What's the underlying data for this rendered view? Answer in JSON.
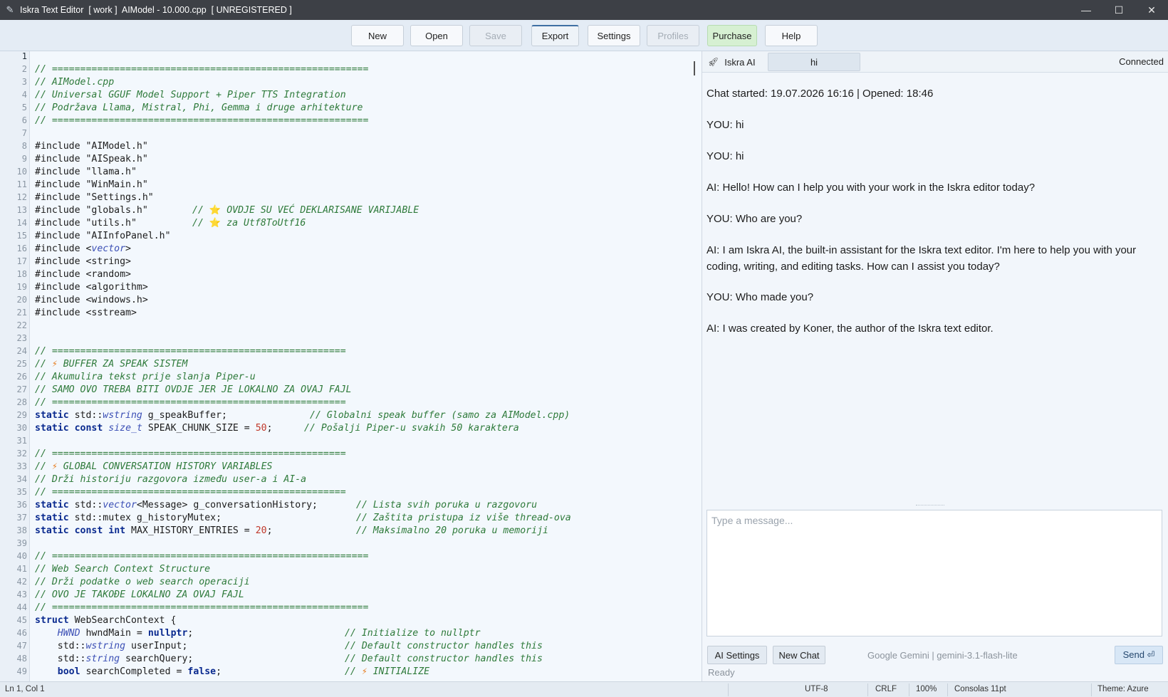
{
  "window": {
    "title": "Iskra Text Editor  [ work ]  AIModel - 10.000.cpp  [ UNREGISTERED ]",
    "app_icon": "quill-pen-icon"
  },
  "toolbar": {
    "new": "New",
    "open": "Open",
    "save": "Save",
    "export": "Export",
    "settings": "Settings",
    "profiles": "Profiles",
    "purchase": "Purchase",
    "help": "Help"
  },
  "editor": {
    "language": "cpp",
    "lines": [
      {
        "n": "1",
        "code": ""
      },
      {
        "n": "2",
        "code": "// ========================================================"
      },
      {
        "n": "3",
        "code": "// AIModel.cpp"
      },
      {
        "n": "4",
        "code": "// Universal GGUF Model Support + Piper TTS Integration"
      },
      {
        "n": "5",
        "code": "// Podržava Llama, Mistral, Phi, Gemma i druge arhitekture"
      },
      {
        "n": "6",
        "code": "// ========================================================"
      },
      {
        "n": "7",
        "code": ""
      },
      {
        "n": "8",
        "code": "#include \"AIModel.h\""
      },
      {
        "n": "9",
        "code": "#include \"AISpeak.h\""
      },
      {
        "n": "10",
        "code": "#include \"llama.h\""
      },
      {
        "n": "11",
        "code": "#include \"WinMain.h\""
      },
      {
        "n": "12",
        "code": "#include \"Settings.h\""
      },
      {
        "n": "13",
        "code": "#include \"globals.h\"",
        "comment": "// ⭐ OVDJE SU VEĆ DEKLARISANE VARIJABLE"
      },
      {
        "n": "14",
        "code": "#include \"utils.h\"",
        "comment": "// ⭐ za Utf8ToUtf16"
      },
      {
        "n": "15",
        "code": "#include \"AIInfoPanel.h\""
      },
      {
        "n": "16",
        "code": "#include <vector>"
      },
      {
        "n": "17",
        "code": "#include <string>"
      },
      {
        "n": "18",
        "code": "#include <random>"
      },
      {
        "n": "19",
        "code": "#include <algorithm>"
      },
      {
        "n": "20",
        "code": "#include <windows.h>"
      },
      {
        "n": "21",
        "code": "#include <sstream>"
      },
      {
        "n": "22",
        "code": ""
      },
      {
        "n": "23",
        "code": ""
      },
      {
        "n": "24",
        "code": "// ===================================================="
      },
      {
        "n": "25",
        "code": "// ⚡ BUFFER ZA SPEAK SISTEM"
      },
      {
        "n": "26",
        "code": "// Akumulira tekst prije slanja Piper-u"
      },
      {
        "n": "27",
        "code": "// SAMO OVO TREBA BITI OVDJE JER JE LOKALNO ZA OVAJ FAJL"
      },
      {
        "n": "28",
        "code": "// ===================================================="
      },
      {
        "n": "29",
        "code": "static std::wstring g_speakBuffer;",
        "comment": "// Globalni speak buffer (samo za AIModel.cpp)"
      },
      {
        "n": "30",
        "code": "static const size_t SPEAK_CHUNK_SIZE = 50;",
        "comment": "// Pošalji Piper-u svakih 50 karaktera"
      },
      {
        "n": "31",
        "code": ""
      },
      {
        "n": "32",
        "code": "// ===================================================="
      },
      {
        "n": "33",
        "code": "// ⚡ GLOBAL CONVERSATION HISTORY VARIABLES"
      },
      {
        "n": "34",
        "code": "// Drži historiju razgovora između user-a i AI-a"
      },
      {
        "n": "35",
        "code": "// ===================================================="
      },
      {
        "n": "36",
        "code": "static std::vector<Message> g_conversationHistory;",
        "comment": "// Lista svih poruka u razgovoru"
      },
      {
        "n": "37",
        "code": "static std::mutex g_historyMutex;",
        "comment": "// Zaštita pristupa iz više thread-ova"
      },
      {
        "n": "38",
        "code": "static const int MAX_HISTORY_ENTRIES = 20;",
        "comment": "// Maksimalno 20 poruka u memoriji"
      },
      {
        "n": "39",
        "code": ""
      },
      {
        "n": "40",
        "code": "// ========================================================"
      },
      {
        "n": "41",
        "code": "// Web Search Context Structure"
      },
      {
        "n": "42",
        "code": "// Drži podatke o web search operaciji"
      },
      {
        "n": "43",
        "code": "// OVO JE TAKOĐE LOKALNO ZA OVAJ FAJL"
      },
      {
        "n": "44",
        "code": "// ========================================================"
      },
      {
        "n": "45",
        "code": "struct WebSearchContext {"
      },
      {
        "n": "46",
        "code": "    HWND hwndMain = nullptr;",
        "comment": "// Initialize to nullptr"
      },
      {
        "n": "47",
        "code": "    std::wstring userInput;",
        "comment": "// Default constructor handles this"
      },
      {
        "n": "48",
        "code": "    std::string searchQuery;",
        "comment": "// Default constructor handles this"
      },
      {
        "n": "49",
        "code": "    bool searchCompleted = false;",
        "comment": "// ⚡ INITIALIZE"
      }
    ]
  },
  "ai_panel": {
    "tab_ai_label": "Iskra AI",
    "tab_ai_icon": "rocket-icon",
    "tab_chat_label": "hi",
    "connection_status": "Connected",
    "messages": [
      "Chat started: 19.07.2026  16:16   |   Opened: 18:46",
      "YOU: hi",
      "YOU: hi",
      "AI: Hello! How can I help you with your work in the Iskra editor today?",
      "YOU: Who are you?",
      "AI: I am Iskra AI, the built-in assistant for the Iskra text editor. I'm here to help you with your coding, writing, and editing tasks. How can I assist you today?",
      "YOU: Who made you?",
      "AI: I was created by Koner, the author of the Iskra text editor."
    ],
    "input_placeholder": "Type a message...",
    "ai_settings_label": "AI Settings",
    "new_chat_label": "New Chat",
    "model_label": "Google Gemini | gemini-3.1-flash-lite",
    "send_label": "Send ⏎",
    "ready_text": "Ready"
  },
  "statusbar": {
    "position": "Ln 1, Col 1",
    "encoding": "UTF-8",
    "line_ending": "CRLF",
    "zoom": "100%",
    "font": "Consolas 11pt",
    "theme": "Theme: Azure"
  },
  "colors": {
    "titlebar": "#3d4046",
    "editor_bg": "#f3f8fd",
    "comment": "#2e7a3a",
    "keyword": "#0a2a8f",
    "purchase_bg": "#d6f0d2"
  }
}
